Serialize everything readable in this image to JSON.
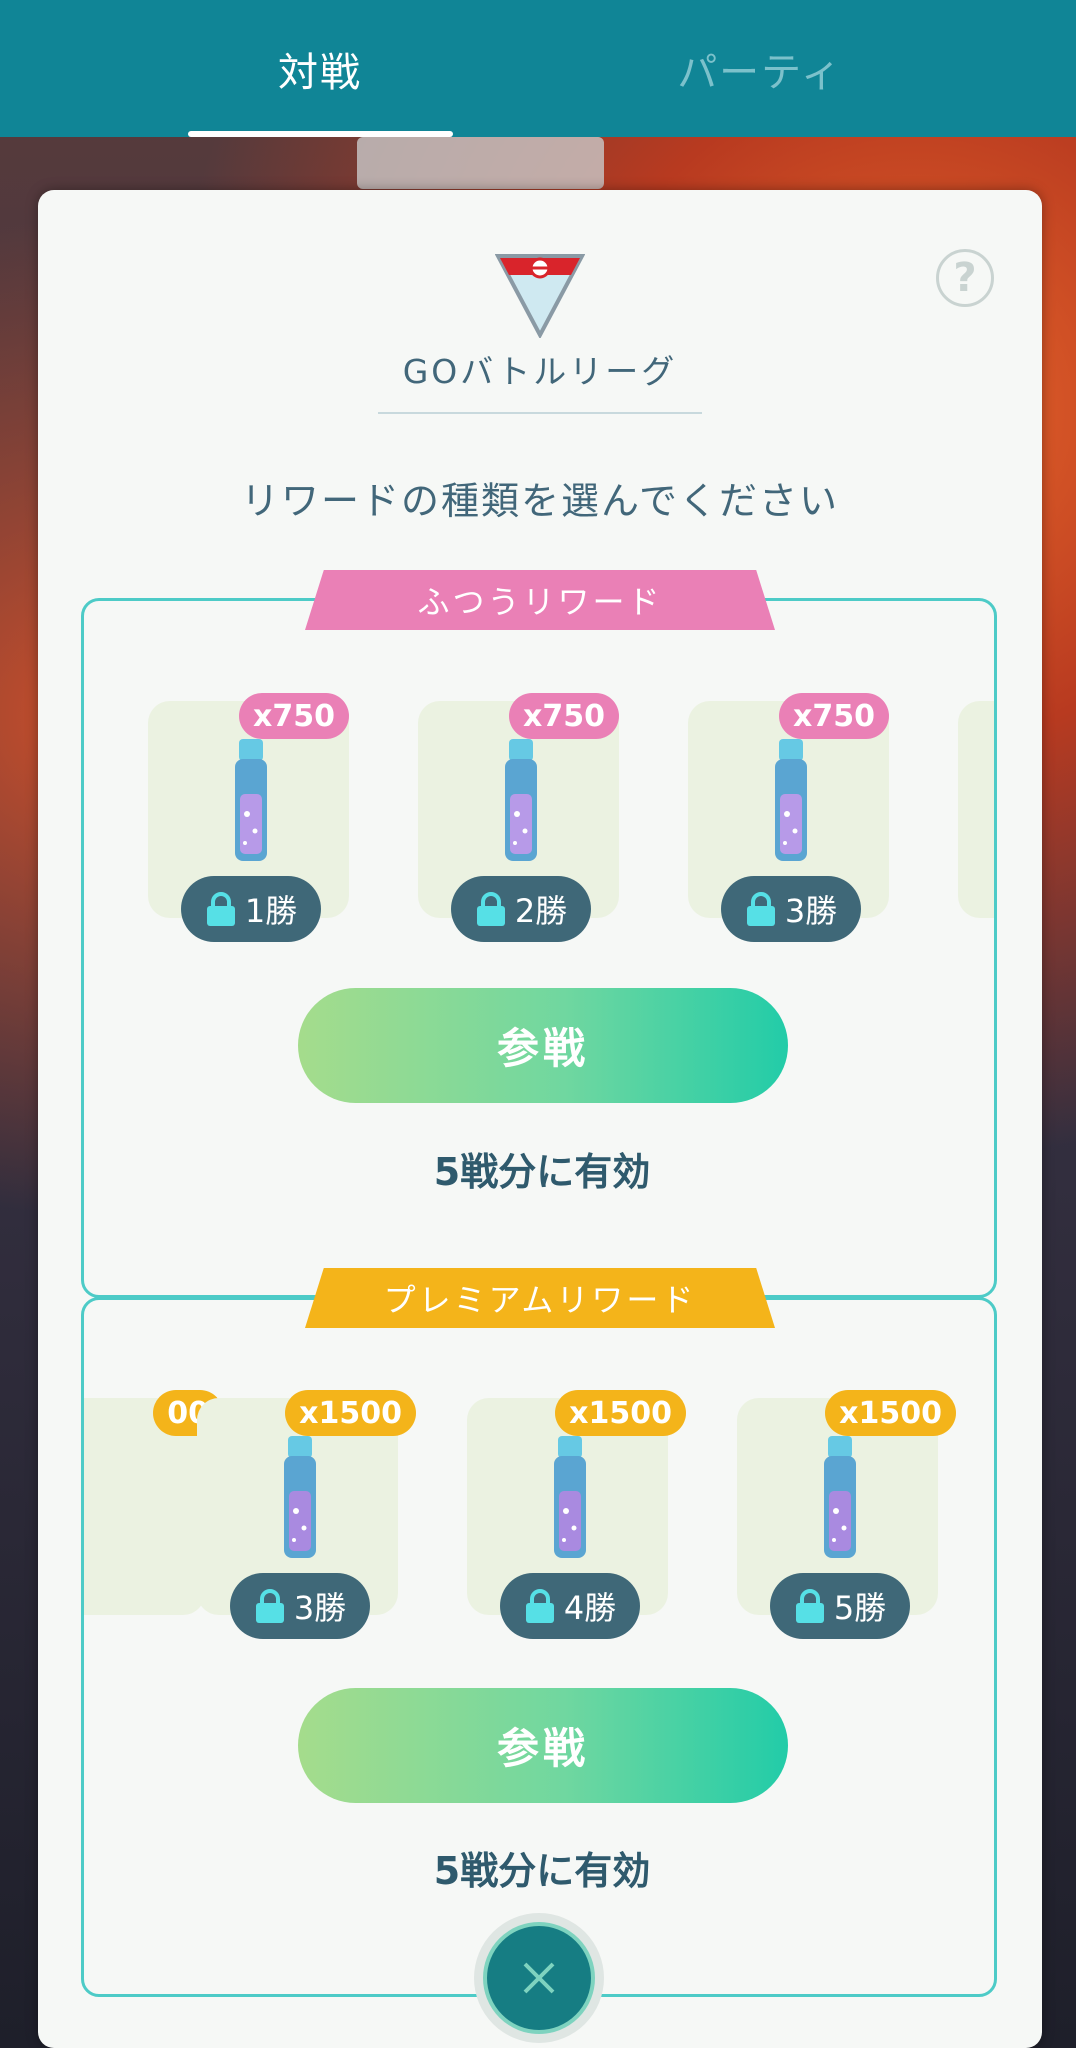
{
  "tabs": {
    "battle": "対戦",
    "party": "パーティ"
  },
  "league": {
    "title": "GOバトルリーグ",
    "help": "?"
  },
  "instruction": "リワードの種類を選んでください",
  "normal": {
    "ribbon": "ふつうリワード",
    "items": [
      {
        "qty": "x750",
        "wins": "1勝"
      },
      {
        "qty": "x750",
        "wins": "2勝"
      },
      {
        "qty": "x750",
        "wins": "3勝"
      }
    ],
    "join": "参戦",
    "validity": "5戦分に有効"
  },
  "premium": {
    "ribbon": "プレミアムリワード",
    "partial_qty": "00",
    "items": [
      {
        "qty": "x1500",
        "wins": "3勝"
      },
      {
        "qty": "x1500",
        "wins": "4勝"
      },
      {
        "qty": "x1500",
        "wins": "5勝"
      }
    ],
    "join": "参戦",
    "validity": "5戦分に有効"
  },
  "colors": {
    "tabbar": "#108596",
    "normal_accent": "#ea80b6",
    "premium_accent": "#f4b41a",
    "border": "#4dcbc7"
  },
  "icons": [
    "league-emblem-icon",
    "help-icon",
    "stardust-potion-icon",
    "lock-icon",
    "close-icon"
  ]
}
